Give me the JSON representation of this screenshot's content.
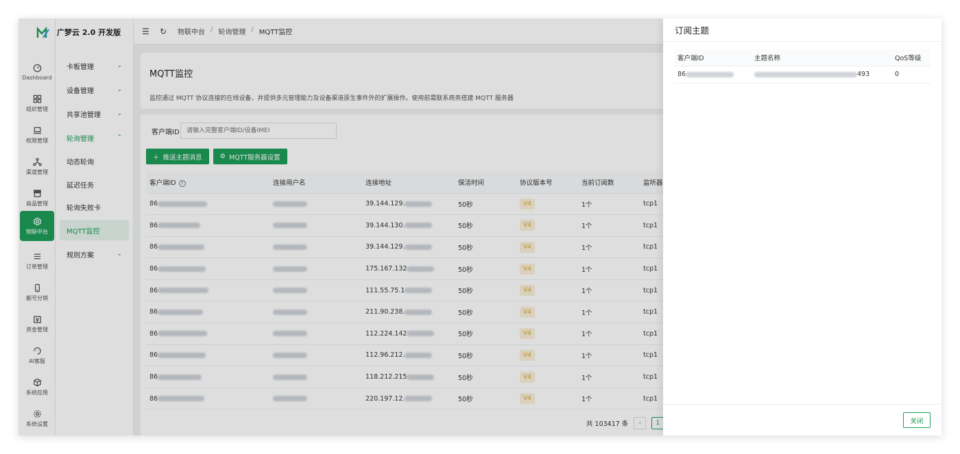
{
  "app": {
    "brand": "广梦云 2.0 开发版"
  },
  "rail": {
    "items": [
      {
        "label": "Dashboard",
        "icon": "dashboard-icon"
      },
      {
        "label": "组织管理",
        "icon": "org-icon"
      },
      {
        "label": "权限管理",
        "icon": "laptop-icon"
      },
      {
        "label": "渠道管理",
        "icon": "channel-icon"
      },
      {
        "label": "商品管理",
        "icon": "shop-icon"
      },
      {
        "label": "物联中台",
        "icon": "iot-icon"
      },
      {
        "label": "订单管理",
        "icon": "menu-icon"
      },
      {
        "label": "靓号分销",
        "icon": "phone-icon"
      },
      {
        "label": "资金管理",
        "icon": "yuan-icon"
      },
      {
        "label": "AI客服",
        "icon": "ai-icon"
      },
      {
        "label": "系统应用",
        "icon": "cube-icon"
      },
      {
        "label": "系统设置",
        "icon": "gear-icon"
      }
    ]
  },
  "submenu": {
    "items": [
      {
        "label": "卡板管理",
        "chev": "⌄"
      },
      {
        "label": "设备管理",
        "chev": "⌄"
      },
      {
        "label": "共享池管理",
        "chev": "⌄"
      },
      {
        "label": "轮询管理",
        "chev": "⌃"
      },
      {
        "label": "动态轮询",
        "chev": ""
      },
      {
        "label": "延迟任务",
        "chev": ""
      },
      {
        "label": "轮询失败卡",
        "chev": ""
      },
      {
        "label": "MQTT监控",
        "chev": ""
      },
      {
        "label": "规则方案",
        "chev": "⌄"
      }
    ]
  },
  "breadcrumb": {
    "c1": "物联中台",
    "c2": "轮询管理",
    "c3": "MQTT监控",
    "sep": "/"
  },
  "page": {
    "title": "MQTT监控",
    "desc": "监控通过 MQTT 协议连接的在线设备，并提供多元管理能力及设备渠道原生事件外的扩展操作。使用前需联系商务搭建 MQTT 服务器"
  },
  "filter": {
    "label": "客户端ID",
    "placeholder": "请输入完整客户端ID/设备IMEI"
  },
  "actions": {
    "push": "推送主题消息",
    "settings": "MQTT服务器设置"
  },
  "table": {
    "headers": [
      "客户端ID",
      "连接用户名",
      "连接地址",
      "保活时间",
      "协议版本号",
      "当前订阅数",
      "监听器"
    ],
    "rows": [
      {
        "id": "86",
        "addr": "39.144.129.",
        "keep": "50秒",
        "ver": "V4",
        "subs": "1个",
        "lis": "tcp1"
      },
      {
        "id": "86",
        "addr": "39.144.130.",
        "keep": "50秒",
        "ver": "V4",
        "subs": "1个",
        "lis": "tcp1"
      },
      {
        "id": "86",
        "addr": "39.144.129.",
        "keep": "50秒",
        "ver": "V4",
        "subs": "1个",
        "lis": "tcp1"
      },
      {
        "id": "86",
        "addr": "175.167.132",
        "keep": "50秒",
        "ver": "V4",
        "subs": "1个",
        "lis": "tcp1"
      },
      {
        "id": "86",
        "addr": "111.55.75.1",
        "keep": "50秒",
        "ver": "V4",
        "subs": "1个",
        "lis": "tcp1"
      },
      {
        "id": "86",
        "addr": "211.90.238.",
        "keep": "50秒",
        "ver": "V4",
        "subs": "1个",
        "lis": "tcp1"
      },
      {
        "id": "86",
        "addr": "112.224.142",
        "keep": "50秒",
        "ver": "V4",
        "subs": "1个",
        "lis": "tcp1"
      },
      {
        "id": "86",
        "addr": "112.96.212.",
        "keep": "50秒",
        "ver": "V4",
        "subs": "1个",
        "lis": "tcp1"
      },
      {
        "id": "86",
        "addr": "118.212.215",
        "keep": "50秒",
        "ver": "V4",
        "subs": "1个",
        "lis": "tcp1"
      },
      {
        "id": "86",
        "addr": "220.197.12.",
        "keep": "50秒",
        "ver": "V4",
        "subs": "1个",
        "lis": "tcp1"
      }
    ]
  },
  "pager": {
    "total": "共 103417 条",
    "prev": "‹",
    "current": "1"
  },
  "drawer": {
    "title": "订阅主题",
    "headers": [
      "客户端ID",
      "主题名称",
      "QoS等级"
    ],
    "rows": [
      {
        "id": "86",
        "topic_suffix": "493",
        "qos": "0"
      }
    ],
    "close": "关闭"
  },
  "colors": {
    "accent": "#1e9e5a",
    "badge_bg": "#fbf0d8",
    "badge_fg": "#d4a23c"
  }
}
